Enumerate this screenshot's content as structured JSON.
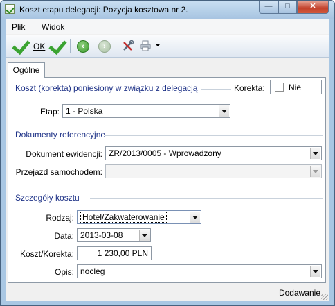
{
  "window": {
    "title": "Koszt etapu delegacji: Pozycja kosztowa nr 2."
  },
  "menu": [
    {
      "label": "Plik"
    },
    {
      "label": "Widok"
    }
  ],
  "toolbar": {
    "ok_label": "OK"
  },
  "tabs": [
    {
      "label": "Ogólne"
    }
  ],
  "koszt": {
    "section_title": "Koszt (korekta) poniesiony w związku z delegacją",
    "korekta_label": "Korekta:",
    "korekta_checkbox_label": "Nie",
    "korekta_checked": false,
    "etap_label": "Etap:",
    "etap_value": "1 - Polska"
  },
  "dokumenty": {
    "section_title": "Dokumenty referencyjne",
    "dokument_label": "Dokument ewidencji:",
    "dokument_value": "ZR/2013/0005 - Wprowadzony",
    "przejazd_label": "Przejazd samochodem:",
    "przejazd_value": ""
  },
  "szczegoly": {
    "section_title": "Szczegóły kosztu",
    "rodzaj_label": "Rodzaj:",
    "rodzaj_value": "Hotel/Zakwaterowanie",
    "data_label": "Data:",
    "data_value": "2013-03-08",
    "koszt_label": "Koszt/Korekta:",
    "koszt_value": "1 230,00 PLN",
    "opis_label": "Opis:",
    "opis_value": "nocleg"
  },
  "status": {
    "text": "Dodawanie"
  },
  "icons": {
    "app": "checkmark-icon",
    "ok": "green-check-icon",
    "ok_new": "green-check-plus-icon",
    "back": "arrow-left-icon",
    "forward": "arrow-right-icon",
    "tools": "tools-icon",
    "print": "printer-icon"
  }
}
